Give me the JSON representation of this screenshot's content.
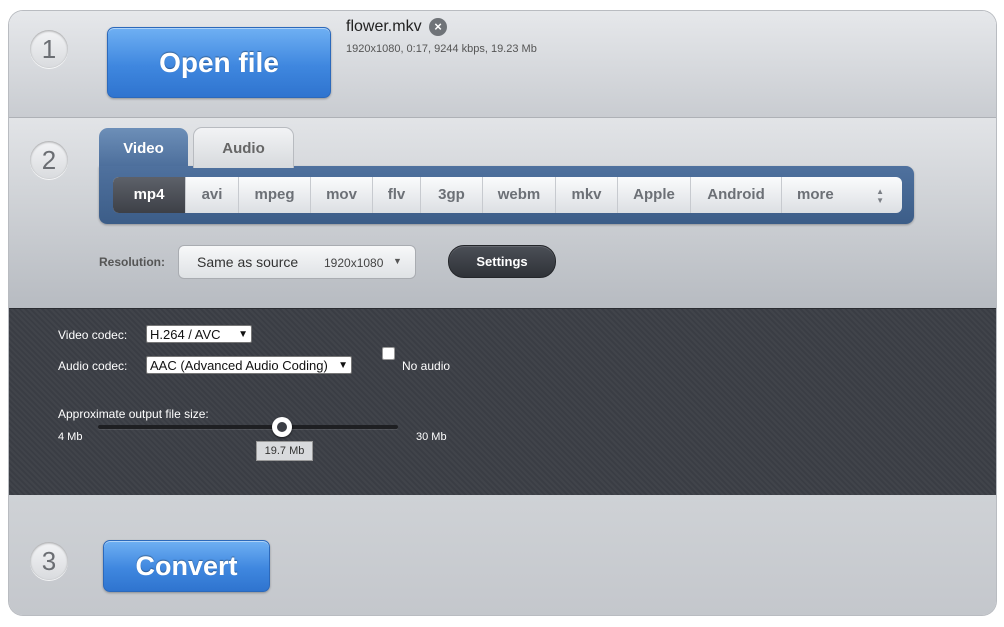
{
  "steps": {
    "one": "1",
    "two": "2",
    "three": "3"
  },
  "open_file": {
    "label": "Open file"
  },
  "file": {
    "name": "flower.mkv",
    "remove_icon": "close-icon",
    "info": "1920x1080, 0:17, 9244 kbps, 19.23 Mb"
  },
  "tabs": [
    {
      "label": "Video",
      "active": true
    },
    {
      "label": "Audio",
      "active": false
    }
  ],
  "formats": [
    {
      "label": "mp4",
      "active": true
    },
    {
      "label": "avi"
    },
    {
      "label": "mpeg"
    },
    {
      "label": "mov"
    },
    {
      "label": "flv"
    },
    {
      "label": "3gp"
    },
    {
      "label": "webm"
    },
    {
      "label": "mkv"
    },
    {
      "label": "Apple"
    },
    {
      "label": "Android"
    },
    {
      "label": "more"
    }
  ],
  "resolution": {
    "label": "Resolution:",
    "value": "Same as source",
    "dims": "1920x1080"
  },
  "settings": {
    "label": "Settings"
  },
  "codecs": {
    "video_label": "Video codec:",
    "video_value": "H.264 / AVC",
    "audio_label": "Audio codec:",
    "audio_value": "AAC (Advanced Audio Coding)",
    "no_audio_label": "No audio",
    "no_audio_checked": false
  },
  "size": {
    "label": "Approximate output file size:",
    "min_label": "4 Mb",
    "max_label": "30 Mb",
    "current_label": "19.7 Mb",
    "value": 19.7,
    "min": 4,
    "max": 30
  },
  "convert": {
    "label": "Convert"
  },
  "colors": {
    "accent_blue": "#3f87df",
    "tab_blue": "#4d6f9c",
    "dark_panel": "#3a3d44"
  }
}
